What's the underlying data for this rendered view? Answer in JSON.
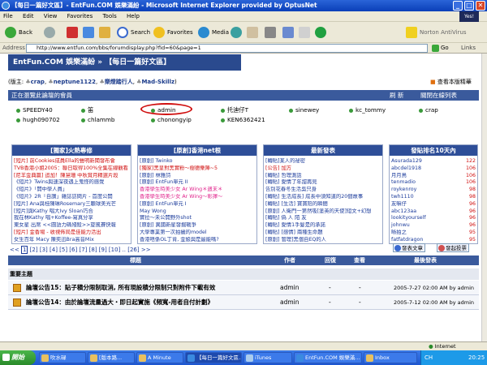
{
  "window": {
    "title": "【每日一篇好文區】- EntFun.COM 娛樂滿紛 - Microsoft Internet Explorer provided by OptusNet",
    "min": "_",
    "max": "□",
    "close": "✕"
  },
  "menu": {
    "items": [
      "File",
      "Edit",
      "View",
      "Favorites",
      "Tools",
      "Help"
    ],
    "logo": "Yes!"
  },
  "toolbar": {
    "back": "Back",
    "search": "Search",
    "favorites": "Favorites",
    "media": "Media",
    "norton": "Norton AntiVirus"
  },
  "address": {
    "label": "Address",
    "url": "http://www.entfun.com/bbs/forumdisplay.php?fid=60&page=1",
    "go": "Go",
    "links": "Links"
  },
  "forum": {
    "breadcrumb": "EntFun.COM 娛樂滿紛 » 【每日一篇好文區】",
    "moderators_label": "(版主:",
    "moderators": [
      "crap",
      "neptune1122",
      "樂燈踏行人",
      "Mad-Skillz"
    ],
    "moderators_close": ")",
    "view_mode": "查看本版精華",
    "online_title": "正在瀏覽此論壇的會員",
    "refresh": "刷 新",
    "close_list": "關閉在線列表",
    "members": [
      "SPEEDY40",
      "笛",
      "admin",
      "托迪仔T",
      "sinewey",
      "kc_tommy",
      "crap",
      "hugh090702",
      "chlammb",
      "chonongyip",
      "KEN6362421"
    ]
  },
  "panels": {
    "hot": {
      "title": "[獨家]火熱專修",
      "items": [
        {
          "text": "[短片] 前Cookies成員Ella的聲明新聞發布會",
          "color": "red"
        },
        {
          "text": "TVB香港小姐2005：聯日取得100%全集在線觀看",
          "color": "red"
        },
        {
          "text": "[尼羊金典篇] 追加！陳慧珊 中秋賞月精選片段",
          "color": "red"
        },
        {
          "text": "《短片》Twins與速深夜遇上鬼怪的感覺",
          "color": "blue"
        },
        {
          "text": "《短片》「開中學人員」",
          "color": "blue"
        },
        {
          "text": "《短片》2R「自讚」雜誌訪問片 - 首度公開",
          "color": "blue"
        },
        {
          "text": "[短片] Ana與桂陳琳Rosemary三顆球美光芒",
          "color": "blue"
        },
        {
          "text": "[短片]與Kathy 唱大Ivy Sloan巧合",
          "color": "blue"
        },
        {
          "text": "我在林Kathy 唱+Koffee-寫真分享",
          "color": "blue"
        },
        {
          "text": "東女星 出席 <<圓語力碼殘殺>>旋風賽快報",
          "color": "blue"
        },
        {
          "text": "[短片] 金香場 - 收視佈局是佳能力活出",
          "color": "red"
        },
        {
          "text": "女生百年 Macy 陳奕迅Bra高音Mix",
          "color": "blue"
        },
        {
          "text": "[短片] 林志玲醫院記錄 喜劇姐姐悟道超出其前",
          "color": "red"
        }
      ]
    },
    "hk": {
      "title": "[原創]香港net根",
      "items": [
        {
          "text": "[原創] Twinko",
          "color": "blue"
        },
        {
          "text": "[獨家]黑皇對黑實粉～樹德樂陣~5",
          "color": "red"
        },
        {
          "text": "[原創] 林雅詩",
          "color": "blue"
        },
        {
          "text": "[原創] EntFun單元 II",
          "color": "blue"
        },
        {
          "text": "香港學生時美少女 Ar Wing＊週末＊",
          "color": "pink"
        },
        {
          "text": "香港學生時美少女 Ar Wing～彰擇～",
          "color": "pink"
        },
        {
          "text": "[原創] EntFun單元 I",
          "color": "blue"
        },
        {
          "text": "May Wong",
          "color": "blue"
        },
        {
          "text": "實拉～未公開野外shot",
          "color": "blue"
        },
        {
          "text": "[原創] 異國新星發掘戰爭",
          "color": "blue"
        },
        {
          "text": "大學專業第一次拍攝的model",
          "color": "blue"
        },
        {
          "text": "香港唔係OL丁肯, 金娘與是最能嗎?",
          "color": "blue"
        }
      ]
    },
    "latest": {
      "title": "最新發表",
      "items": [
        {
          "text": "[轉貼]某人的祕密",
          "color": "blue"
        },
        {
          "text": "[公告] 加方",
          "color": "red"
        },
        {
          "text": "[轉貼] 哲理測話",
          "color": "blue"
        },
        {
          "text": "[轉貼] 愛情了年甜再見",
          "color": "blue"
        },
        {
          "text": "告別花春冬生活吳只身",
          "color": "blue"
        },
        {
          "text": "[轉貼] 生活成長] 成長中須知道的20個故事",
          "color": "blue"
        },
        {
          "text": "[轉貼] [生活] 寶寶陪的瞬間",
          "color": "blue"
        },
        {
          "text": "[原創] 人衛門一第然吸[塗英的天使]短文+幻想",
          "color": "blue"
        },
        {
          "text": "[轉貼] 偽 人 陌 友",
          "color": "blue"
        },
        {
          "text": "[轉貼] 愛情1手髮是的承諾",
          "color": "blue"
        },
        {
          "text": "[轉貼] [感情] 兩種生命題",
          "color": "blue"
        },
        {
          "text": "[原創] 管理]黑個自EQ的人",
          "color": "blue"
        }
      ]
    },
    "ranking": {
      "title": "發貼排名10天內",
      "items": [
        {
          "name": "Asurada129",
          "n": "122"
        },
        {
          "name": "abcdel1918",
          "n": "106"
        },
        {
          "name": "月月鳥",
          "n": "106"
        },
        {
          "name": "tenmadio",
          "n": "106"
        },
        {
          "name": "roykenroy",
          "n": "98"
        },
        {
          "name": "twh1110",
          "n": "98"
        },
        {
          "name": "友嘛仔",
          "n": "96"
        },
        {
          "name": "abc123aa",
          "n": "96"
        },
        {
          "name": "lookityourself",
          "n": "96"
        },
        {
          "name": "johnwu",
          "n": "96"
        },
        {
          "name": "晰拍之",
          "n": "95"
        },
        {
          "name": "fatfatdragon",
          "n": "95"
        },
        {
          "name": "simon0327787",
          "n": "95"
        }
      ]
    }
  },
  "pager": {
    "prev": "<<",
    "pages": [
      "1",
      "2",
      "3",
      "4",
      "5",
      "6",
      "7",
      "8",
      "9",
      "10",
      "..",
      "26"
    ],
    "next": ">>",
    "new_topic": "發表文章",
    "new_poll": "發起投票"
  },
  "table": {
    "headers": {
      "title": "標題",
      "author": "作者",
      "replies": "回復",
      "views": "查看",
      "last": "最後發表"
    },
    "section": "重要主題",
    "rows": [
      {
        "title": "論壇公告15：貼子積分限制取消, 所有現設積分限制只對附件下載有效",
        "author": "admin",
        "replies": "-",
        "views": "-",
        "last": "2005-7-27 02:00 AM by admin"
      },
      {
        "title": "論壇公告14：由於論壇流量過大・即日起實施《頻寬-用者自付計劃》",
        "author": "admin",
        "replies": "-",
        "views": "-",
        "last": "2005-7-12 02:00 AM by admin"
      }
    ]
  },
  "status": {
    "text": "",
    "zone": "Internet"
  },
  "taskbar": {
    "start": "開始",
    "tasks": [
      "吹水碌",
      "[版本路...",
      "A Minute",
      "【每日一篇好文區...",
      "iTunes",
      "EntFun.COM 娛樂滿...",
      "Inbox"
    ],
    "lang": "CH",
    "time": "20:25"
  }
}
